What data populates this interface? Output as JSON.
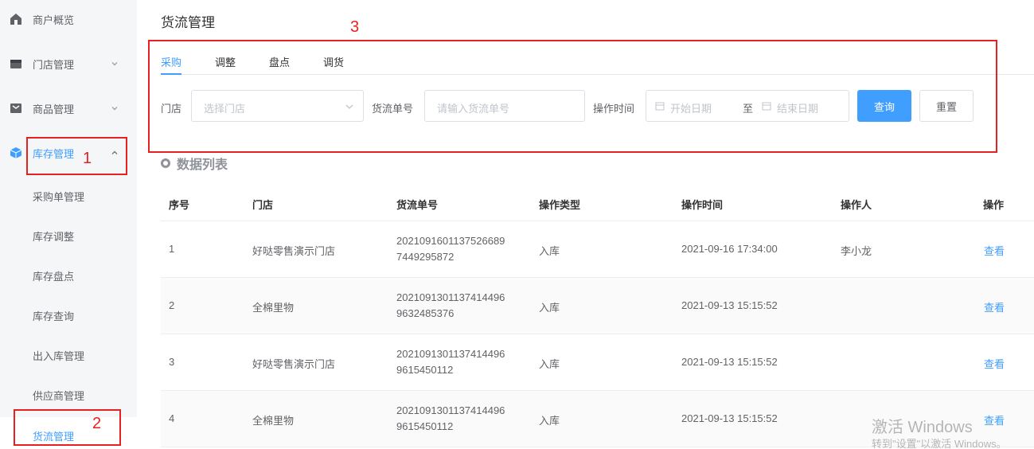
{
  "sidebar": {
    "items": [
      {
        "label": "商户概览",
        "icon": "home-icon"
      },
      {
        "label": "门店管理",
        "icon": "store-icon"
      },
      {
        "label": "商品管理",
        "icon": "goods-icon"
      },
      {
        "label": "库存管理",
        "icon": "cube-icon"
      }
    ],
    "sub_items": [
      "采购单管理",
      "库存调整",
      "库存盘点",
      "库存查询",
      "出入库管理",
      "供应商管理",
      "货流管理"
    ]
  },
  "page": {
    "title": "货流管理"
  },
  "tabs": [
    "采购",
    "调整",
    "盘点",
    "调货"
  ],
  "filters": {
    "store_label": "门店",
    "store_placeholder": "选择门店",
    "order_label": "货流单号",
    "order_placeholder": "请输入货流单号",
    "time_label": "操作时间",
    "start_placeholder": "开始日期",
    "separator": "至",
    "end_placeholder": "结束日期",
    "search_button": "查询",
    "reset_button": "重置"
  },
  "section": {
    "title": "数据列表"
  },
  "table": {
    "columns": [
      "序号",
      "门店",
      "货流单号",
      "操作类型",
      "操作时间",
      "操作人",
      "操作"
    ],
    "rows": [
      {
        "index": "1",
        "store": "好哒零售演示门店",
        "order_line1": "2021091601137526689",
        "order_line2": "7449295872",
        "type": "入库",
        "time": "2021-09-16 17:34:00",
        "operator": "李小龙",
        "action": "查看"
      },
      {
        "index": "2",
        "store": "全棉里物",
        "order_line1": "2021091301137414496",
        "order_line2": "9632485376",
        "type": "入库",
        "time": "2021-09-13 15:15:52",
        "operator": "",
        "action": "查看"
      },
      {
        "index": "3",
        "store": "好哒零售演示门店",
        "order_line1": "2021091301137414496",
        "order_line2": "9615450112",
        "type": "入库",
        "time": "2021-09-13 15:15:52",
        "operator": "",
        "action": "查看"
      },
      {
        "index": "4",
        "store": "全棉里物",
        "order_line1": "2021091301137414496",
        "order_line2": "9615450112",
        "type": "入库",
        "time": "2021-09-13 15:15:52",
        "operator": "",
        "action": "查看"
      }
    ]
  },
  "annotations": [
    "1",
    "2",
    "3"
  ],
  "watermark": {
    "title": "激活 Windows",
    "subtitle": "转到\"设置\"以激活 Windows。"
  },
  "colors": {
    "accent": "#409eff",
    "annotation": "#e8201f"
  }
}
